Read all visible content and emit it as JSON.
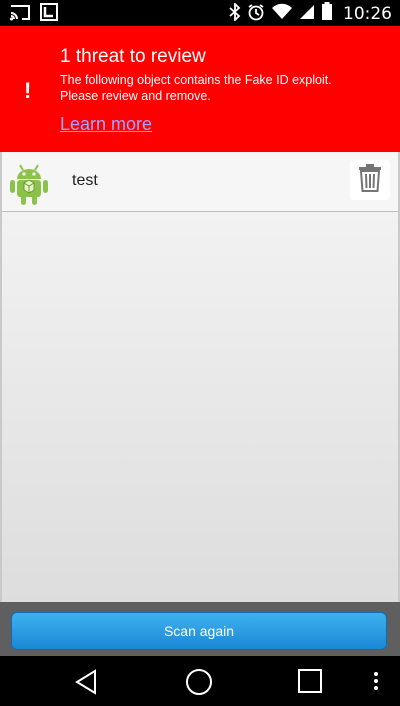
{
  "status_bar": {
    "time": "10:26",
    "icons": [
      "cast-icon",
      "notification-app-icon",
      "bluetooth-icon",
      "alarm-icon",
      "wifi-icon",
      "signal-icon",
      "battery-icon"
    ]
  },
  "banner": {
    "icon_glyph": "!",
    "title": "1 threat to review",
    "description": "The following object contains the Fake ID exploit.\n Please review and remove.",
    "link_text": "Learn more",
    "background_color": "#ff0000"
  },
  "threats": [
    {
      "name": "test",
      "icon": "android-icon"
    }
  ],
  "actions": {
    "scan_button_label": "Scan again"
  },
  "nav_bar": {
    "buttons": [
      "back-icon",
      "home-icon",
      "recents-icon",
      "overflow-menu-icon"
    ]
  }
}
